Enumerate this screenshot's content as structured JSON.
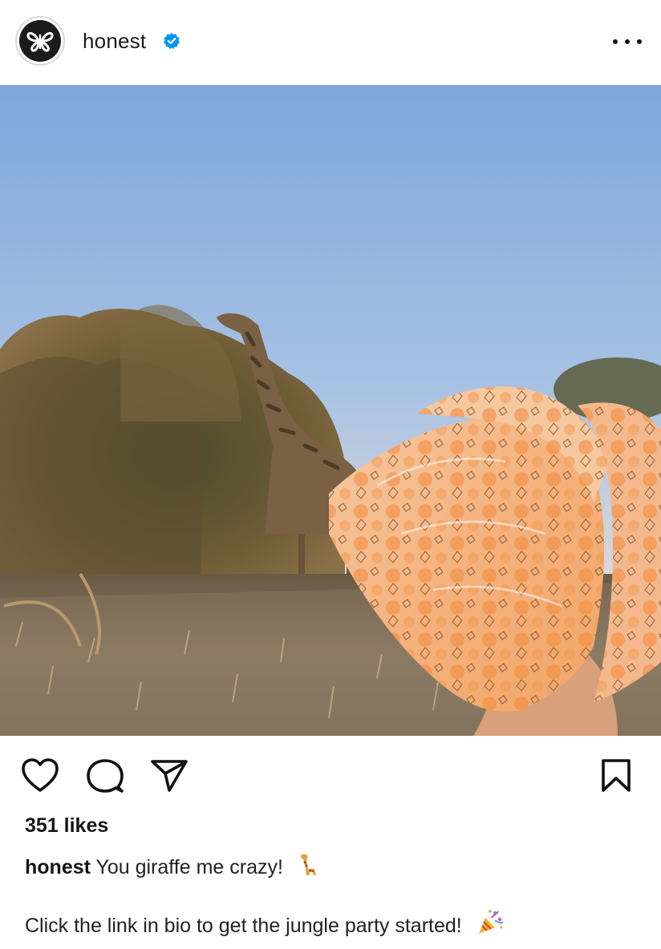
{
  "post": {
    "account": {
      "username": "honest",
      "verified": true,
      "avatar_icon": "butterfly-logo-icon"
    },
    "more_icon": "more-options-icon",
    "image": {
      "description_alt": "Giraffe behind bushes with hand holding giraffe-print diapers"
    },
    "actions": {
      "like_icon": "heart-icon",
      "comment_icon": "comment-icon",
      "share_icon": "paper-plane-icon",
      "save_icon": "bookmark-icon"
    },
    "likes_text": "351 likes",
    "caption": {
      "username": "honest",
      "text": "You giraffe me crazy!",
      "line2": "Click the link in bio to get the jungle party started!"
    }
  },
  "colors": {
    "verified_blue": "#0095f6",
    "text": "#161616"
  }
}
